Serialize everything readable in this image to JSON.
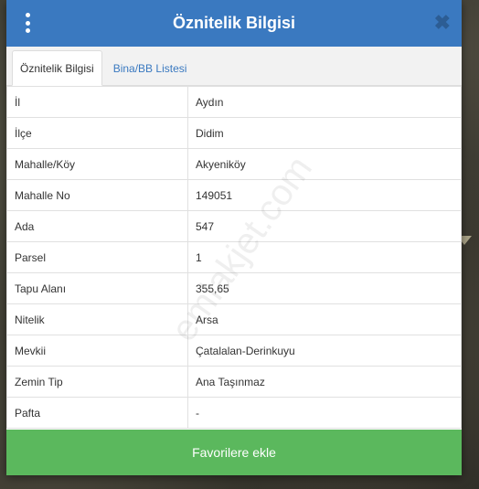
{
  "header": {
    "title": "Öznitelik Bilgisi",
    "close_glyph": "✖"
  },
  "tabs": [
    {
      "label": "Öznitelik Bilgisi",
      "active": true
    },
    {
      "label": "Bina/BB Listesi",
      "active": false
    }
  ],
  "rows": [
    {
      "key": "İl",
      "value": "Aydın"
    },
    {
      "key": "İlçe",
      "value": "Didim"
    },
    {
      "key": "Mahalle/Köy",
      "value": "Akyeniköy"
    },
    {
      "key": "Mahalle No",
      "value": "149051"
    },
    {
      "key": "Ada",
      "value": "547"
    },
    {
      "key": "Parsel",
      "value": "1"
    },
    {
      "key": "Tapu Alanı",
      "value": "355,65"
    },
    {
      "key": "Nitelik",
      "value": "Arsa"
    },
    {
      "key": "Mevkii",
      "value": "Çatalalan-Derinkuyu"
    },
    {
      "key": "Zemin Tip",
      "value": "Ana Taşınmaz"
    },
    {
      "key": "Pafta",
      "value": "-"
    }
  ],
  "footer": {
    "button_label": "Favorilere ekle"
  },
  "watermark": "emlakjet.com",
  "colors": {
    "header": "#3a79c0",
    "footer": "#5bb85d",
    "tab_link": "#3a79c0"
  }
}
